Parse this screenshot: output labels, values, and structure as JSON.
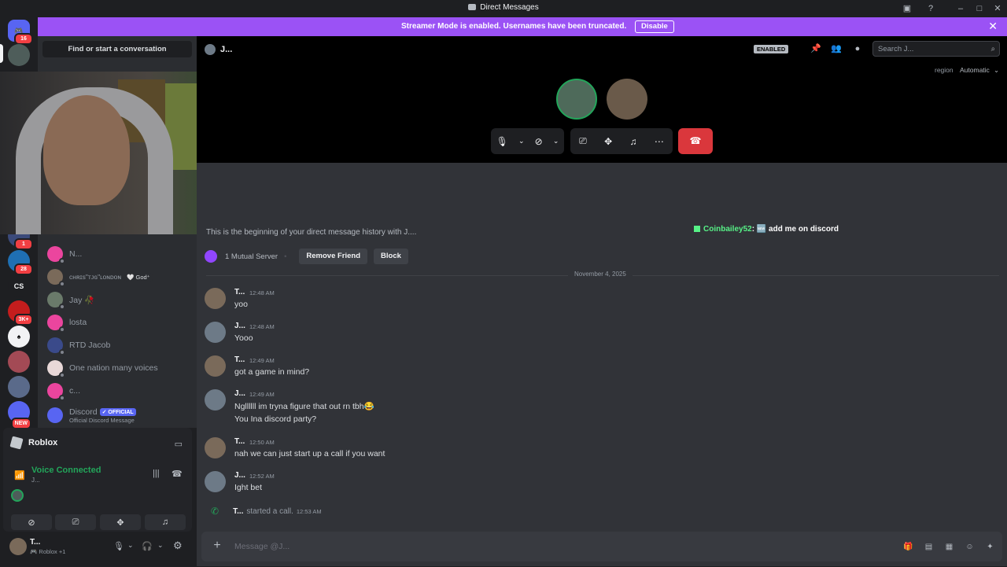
{
  "window": {
    "title": "Direct Messages"
  },
  "streamer_banner": {
    "message": "Streamer Mode is enabled. Usernames have been truncated.",
    "disable_label": "Disable"
  },
  "guilds": [
    {
      "badge": "16",
      "label": ""
    },
    {
      "badge": "",
      "label": ""
    },
    {
      "badge": "1",
      "label": ""
    },
    {
      "badge": "28",
      "label": ""
    },
    {
      "badge": "",
      "label": "CS"
    },
    {
      "badge": "3K+",
      "label": ""
    },
    {
      "badge": "",
      "label": ""
    },
    {
      "badge": "",
      "label": ""
    },
    {
      "badge": "",
      "label": ""
    },
    {
      "badge": "NEW",
      "label": ""
    }
  ],
  "dm_sidebar": {
    "find_placeholder": "Find or start a conversation",
    "items": [
      {
        "name": "N...",
        "tag": ""
      },
      {
        "name": "ᴄʜʀɪs\"ᴛᴊɢ\"ʟᴏɴᴅᴏɴ",
        "tag": "🤍 God⁺"
      },
      {
        "name": "Jay 🥀",
        "tag": ""
      },
      {
        "name": "losta",
        "tag": ""
      },
      {
        "name": "RTD Jacob",
        "tag": ""
      },
      {
        "name": "One nation many voices",
        "tag": ""
      },
      {
        "name": "c...",
        "tag": ""
      },
      {
        "name": "Discord",
        "official": "✓ OFFICIAL",
        "sub": "Official Discord Message"
      }
    ]
  },
  "activity_panel": {
    "game": "Roblox",
    "voice_status": "Voice Connected",
    "voice_channel": "J..."
  },
  "user_bar": {
    "name": "T...",
    "status": "🎮 Roblox +1"
  },
  "header": {
    "dm_name": "J...",
    "enabled_badge": "ENABLED",
    "search_placeholder": "Search J...",
    "region_label": "region",
    "region_value": "Automatic"
  },
  "history": {
    "intro": "This is the beginning of your direct message history with J....",
    "mutual": "1 Mutual Server",
    "remove_friend": "Remove Friend",
    "block": "Block",
    "date": "November 4, 2025"
  },
  "overlay_chat": {
    "user": "Coinbailey52",
    "text": ": 🆕 add me on discord"
  },
  "messages": [
    {
      "author": "T...",
      "time": "12:48 AM",
      "lines": [
        "yoo"
      ]
    },
    {
      "author": "J...",
      "time": "12:48 AM",
      "lines": [
        "Yooo"
      ]
    },
    {
      "author": "T...",
      "time": "12:49 AM",
      "lines": [
        "got a game in mind?"
      ]
    },
    {
      "author": "J...",
      "time": "12:49 AM",
      "lines": [
        "Ngllllll im tryna figure that out rn tbh😂",
        "You Ina discord party?"
      ]
    },
    {
      "author": "T...",
      "time": "12:50 AM",
      "lines": [
        "nah we can just start up a call if you want"
      ]
    },
    {
      "author": "J...",
      "time": "12:52 AM",
      "lines": [
        "Ight bet"
      ]
    }
  ],
  "system_message": {
    "author": "T...",
    "text": "started a call.",
    "time": "12:53 AM"
  },
  "composer": {
    "placeholder": "Message @J..."
  },
  "colors": {
    "accent": "#5865f2",
    "streamer_banner": "#9b52f5",
    "hangup": "#da373c",
    "online": "#23a55a"
  }
}
